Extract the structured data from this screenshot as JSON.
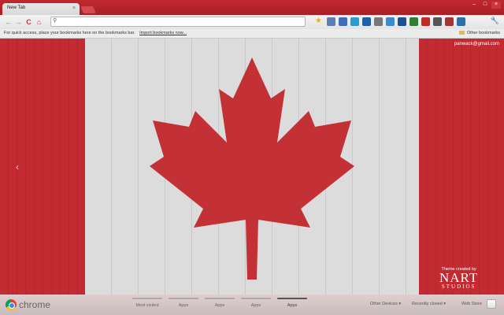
{
  "tab": {
    "title": "New Tab",
    "close": "×"
  },
  "window": {
    "minimize": "–",
    "maximize": "□",
    "close": "×"
  },
  "toolbar": {
    "back": "←",
    "forward": "→",
    "reload": "C",
    "home": "⌂",
    "search_glyph": "⚲",
    "star": "★",
    "wrench": "🔧",
    "url_value": ""
  },
  "extensions": [
    {
      "name": "ext-1",
      "color": "#5a7fb0"
    },
    {
      "name": "ext-2",
      "color": "#3c6fb6"
    },
    {
      "name": "ext-3",
      "color": "#2b9bd2"
    },
    {
      "name": "ext-4",
      "color": "#1f5fa8"
    },
    {
      "name": "ext-5",
      "color": "#777777"
    },
    {
      "name": "ext-6",
      "color": "#3a8cc9"
    },
    {
      "name": "ext-7",
      "color": "#1e4f91"
    },
    {
      "name": "ext-8",
      "color": "#2e7d32"
    },
    {
      "name": "ext-9",
      "color": "#c62828"
    },
    {
      "name": "ext-10",
      "color": "#555555"
    },
    {
      "name": "ext-11",
      "color": "#a83232"
    },
    {
      "name": "ext-12",
      "color": "#2f6fa8"
    }
  ],
  "bookmarks": {
    "hint": "For quick access, place your bookmarks here on the bookmarks bar.",
    "import_link": "Import bookmarks now...",
    "other": "Other bookmarks"
  },
  "content": {
    "user_email": "panwack@gmail.com",
    "left_arrow": "‹",
    "theme_credit": "Theme created by",
    "logo_main": "NART",
    "logo_sub": "STUDIOS"
  },
  "bottom": {
    "brand": "chrome",
    "tabs": [
      {
        "label": "Most visited",
        "active": false
      },
      {
        "label": "Apps",
        "active": false
      },
      {
        "label": "Apps",
        "active": false
      },
      {
        "label": "Apps",
        "active": false
      },
      {
        "label": "Apps",
        "active": true
      }
    ],
    "other_devices": "Other Devices ▾",
    "recently_closed": "Recently closed ▾",
    "web_store": "Web Store"
  },
  "colors": {
    "flag_red": "#c32a31",
    "flag_white": "#dcdcdc",
    "leaf": "#c1272d"
  }
}
